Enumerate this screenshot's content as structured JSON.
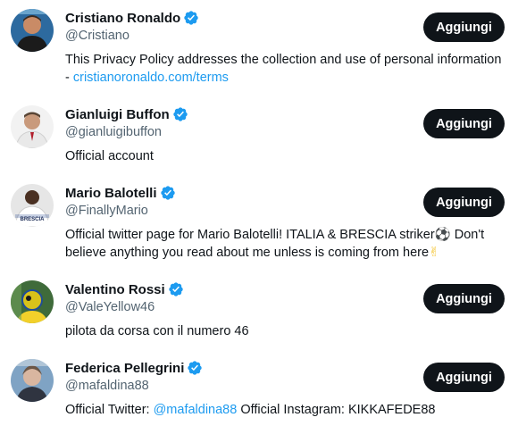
{
  "accounts": [
    {
      "name": "Cristiano Ronaldo",
      "handle": "@Cristiano",
      "bio_text": "This Privacy Policy addresses the collection and use of personal information - ",
      "bio_link": "cristianoronaldo.com/terms",
      "button_label": "Aggiungi",
      "avatar_icon": "avatar-cristiano-ronaldo"
    },
    {
      "name": "Gianluigi Buffon",
      "handle": "@gianluigibuffon",
      "bio_text": "Official account",
      "button_label": "Aggiungi",
      "avatar_icon": "avatar-gianluigi-buffon"
    },
    {
      "name": "Mario Balotelli",
      "handle": "@FinallyMario",
      "bio_text_1": "Official twitter page for Mario Balotelli! ITALIA & BRESCIA striker",
      "bio_emoji_1": "⚽",
      "bio_text_2": " Don't believe anything you read about me unless is coming from here",
      "bio_emoji_2": "✌",
      "button_label": "Aggiungi",
      "avatar_icon": "avatar-mario-balotelli",
      "avatar_text": "BRESCIA"
    },
    {
      "name": "Valentino Rossi",
      "handle": "@ValeYellow46",
      "bio_text": "pilota da corsa con il numero 46",
      "button_label": "Aggiungi",
      "avatar_icon": "avatar-valentino-rossi"
    },
    {
      "name": "Federica Pellegrini",
      "handle": "@mafaldina88",
      "bio_text_1": "Official Twitter: ",
      "bio_mention": "@mafaldina88",
      "bio_text_2": " Official Instagram: KIKKAFEDE88",
      "button_label": "Aggiungi",
      "avatar_icon": "avatar-federica-pellegrini"
    }
  ],
  "colors": {
    "verified": "#1d9bf0",
    "link": "#1d9bf0",
    "button_bg": "#0f1419",
    "secondary_text": "#536471"
  },
  "icons": {
    "verified": "verified-badge-icon"
  }
}
